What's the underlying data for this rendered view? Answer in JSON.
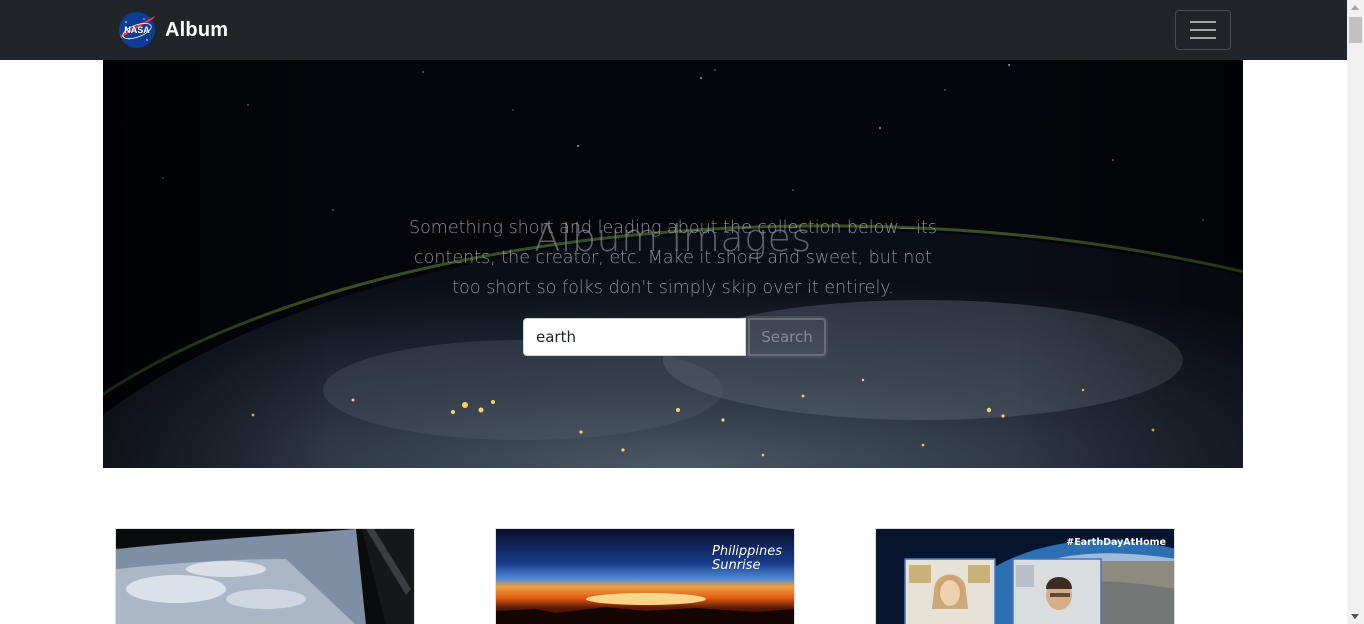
{
  "navbar": {
    "brand_logo": "nasa-meatball-logo",
    "brand_label": "Album",
    "menu_icon": "hamburger-icon"
  },
  "hero": {
    "title": "Album Images",
    "lead": "Something short and leading about the collection below—its contents, the creator, etc. Make it short and sweet, but not too short so folks don't simply skip over it entirely.",
    "search": {
      "value": "earth",
      "button_label": "Search"
    }
  },
  "cards": [
    {
      "image": "earth-from-orbit",
      "caption": ""
    },
    {
      "image": "sunrise-horizon",
      "caption_line1": "Philippines",
      "caption_line2": "Sunrise"
    },
    {
      "image": "video-call-earth-day",
      "caption": "#EarthDayAtHome"
    }
  ],
  "colors": {
    "navbar_bg": "#212529",
    "hero_bg": "#03050a"
  }
}
